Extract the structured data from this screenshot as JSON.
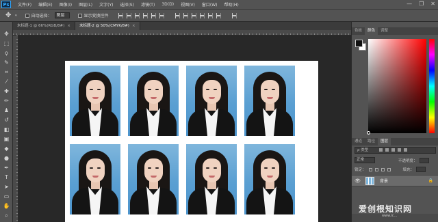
{
  "app": {
    "logo": "Ps"
  },
  "menu": [
    "文件(F)",
    "编辑(E)",
    "图像(I)",
    "图层(L)",
    "文字(Y)",
    "选择(S)",
    "滤镜(T)",
    "3D(D)",
    "视图(V)",
    "窗口(W)",
    "帮助(H)"
  ],
  "window_controls": {
    "minimize": "—",
    "restore": "❐",
    "close": "✕"
  },
  "options": {
    "auto_select_label": "自动选择：",
    "auto_select_value": "图层",
    "show_transform_label": "显示变换控件"
  },
  "tabs": [
    {
      "label": "未标题-1 @ 66%(RGB/8#)",
      "close": "×"
    },
    {
      "label": "未标题-2 @ 50%(CMYK/8#)",
      "close": "×"
    }
  ],
  "panel": {
    "top_tabs": [
      "色板",
      "颜色",
      "调整"
    ],
    "top_active": "颜色",
    "layer_tabs": [
      "通道",
      "路径",
      "图层"
    ],
    "layer_active": "图层",
    "kind_label": "ρ 类型",
    "blend_mode": "正常",
    "opacity_label": "不透明度：",
    "lock_label": "锁定：",
    "fill_label": "填充：",
    "layer_name": "背景",
    "lock_glyph": "🔒"
  },
  "photos": {
    "rows": 2,
    "cols": 4
  },
  "watermark": {
    "text": "爱创根知识网",
    "sub": "www.ic..."
  }
}
